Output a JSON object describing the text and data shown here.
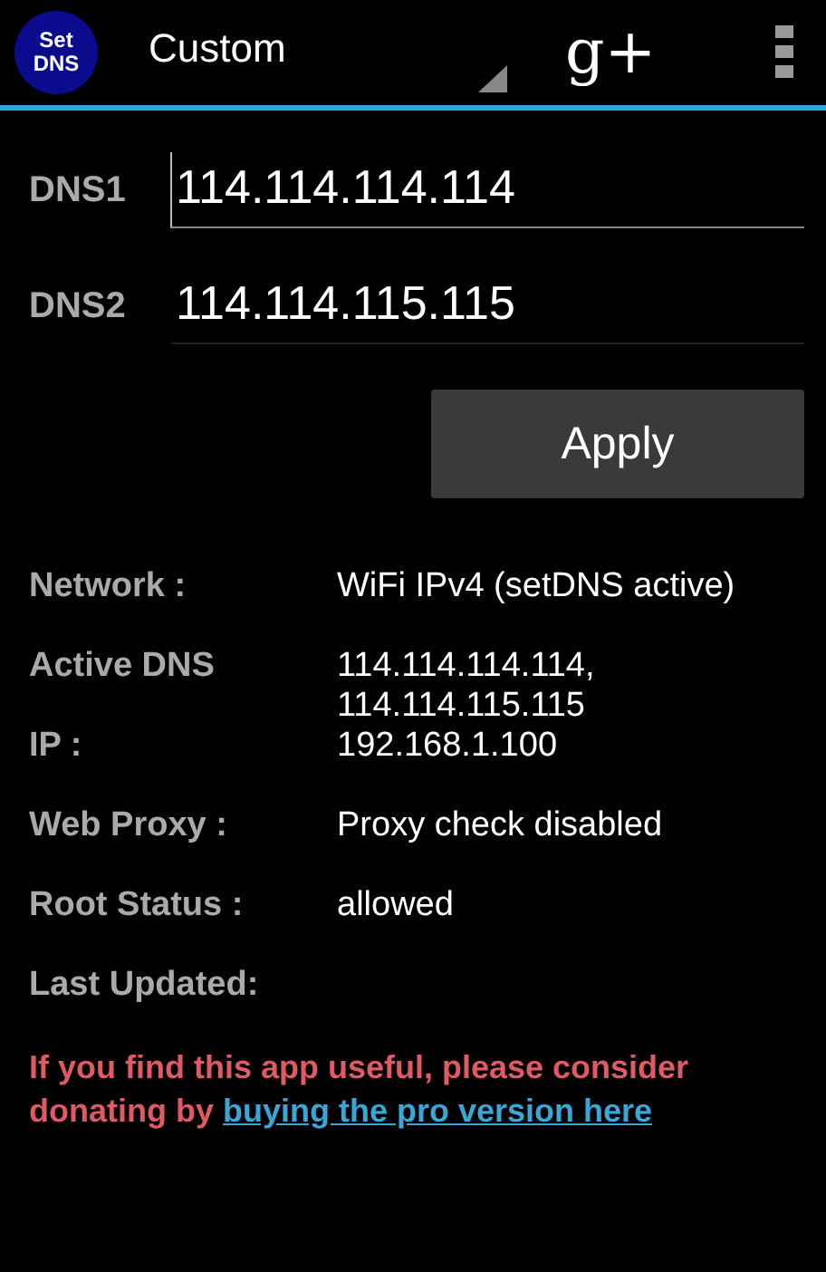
{
  "app_bar": {
    "logo_text": "Set DNS",
    "profile": "Custom",
    "share_label": "g+"
  },
  "fields": [
    {
      "label": "DNS1",
      "value": "114.114.114.114",
      "focused": true
    },
    {
      "label": "DNS2",
      "value": "114.114.115.115",
      "focused": false
    }
  ],
  "apply_button": "Apply",
  "info": [
    {
      "label": "Network :",
      "lines": [
        "WiFi IPv4 (setDNS active)"
      ]
    },
    {
      "label": "Active DNS",
      "lines": [
        "114.114.114.114,",
        "114.114.115.115"
      ]
    },
    {
      "label": "IP :",
      "lines": [
        "192.168.1.100"
      ]
    },
    {
      "label": "Web Proxy :",
      "lines": [
        "Proxy check disabled"
      ]
    },
    {
      "label": "Root Status :",
      "lines": [
        "allowed"
      ]
    },
    {
      "label": "Last Updated:"
    }
  ],
  "donation": {
    "text": "If you find this app useful, please consider donating by",
    "link": "buying the pro version here"
  }
}
